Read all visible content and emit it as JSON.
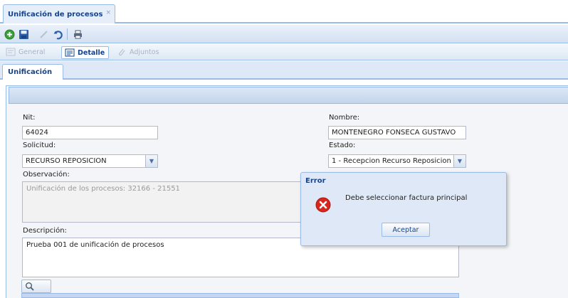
{
  "window": {
    "tab_title": "Unificación de procesos",
    "tab_close": "×"
  },
  "toolbar": {
    "icons": [
      "add-icon",
      "save-icon",
      "edit-icon",
      "undo-icon",
      "print-icon"
    ]
  },
  "subtabs": {
    "general": "General",
    "detalle": "Detalle",
    "adjuntos": "Adjuntos",
    "active": "Detalle"
  },
  "inner_tab": {
    "label": "Unificación"
  },
  "form": {
    "nit_label": "Nit:",
    "nit_value": "64024",
    "nombre_label": "Nombre:",
    "nombre_value": "MONTENEGRO FONSECA GUSTAVO",
    "solicitud_label": "Solicitud:",
    "solicitud_value": "RECURSO REPOSICION",
    "estado_label": "Estado:",
    "estado_value": "1 - Recepcion Recurso Reposicion",
    "observacion_label": "Observación:",
    "observacion_value": "Unificación de los procesos: 32166 - 21551",
    "descripcion_label": "Descripción:",
    "descripcion_value": "Prueba 001 de unificación de procesos"
  },
  "dialog": {
    "title": "Error",
    "message": "Debe seleccionar factura principal",
    "button": "Aceptar"
  },
  "colors": {
    "accent": "#15428b",
    "border": "#99bbe8",
    "panel_bg": "#dfe8f6",
    "error": "#d9261c",
    "add_icon": "#3aa03a",
    "save_icon": "#2a5ea8"
  }
}
